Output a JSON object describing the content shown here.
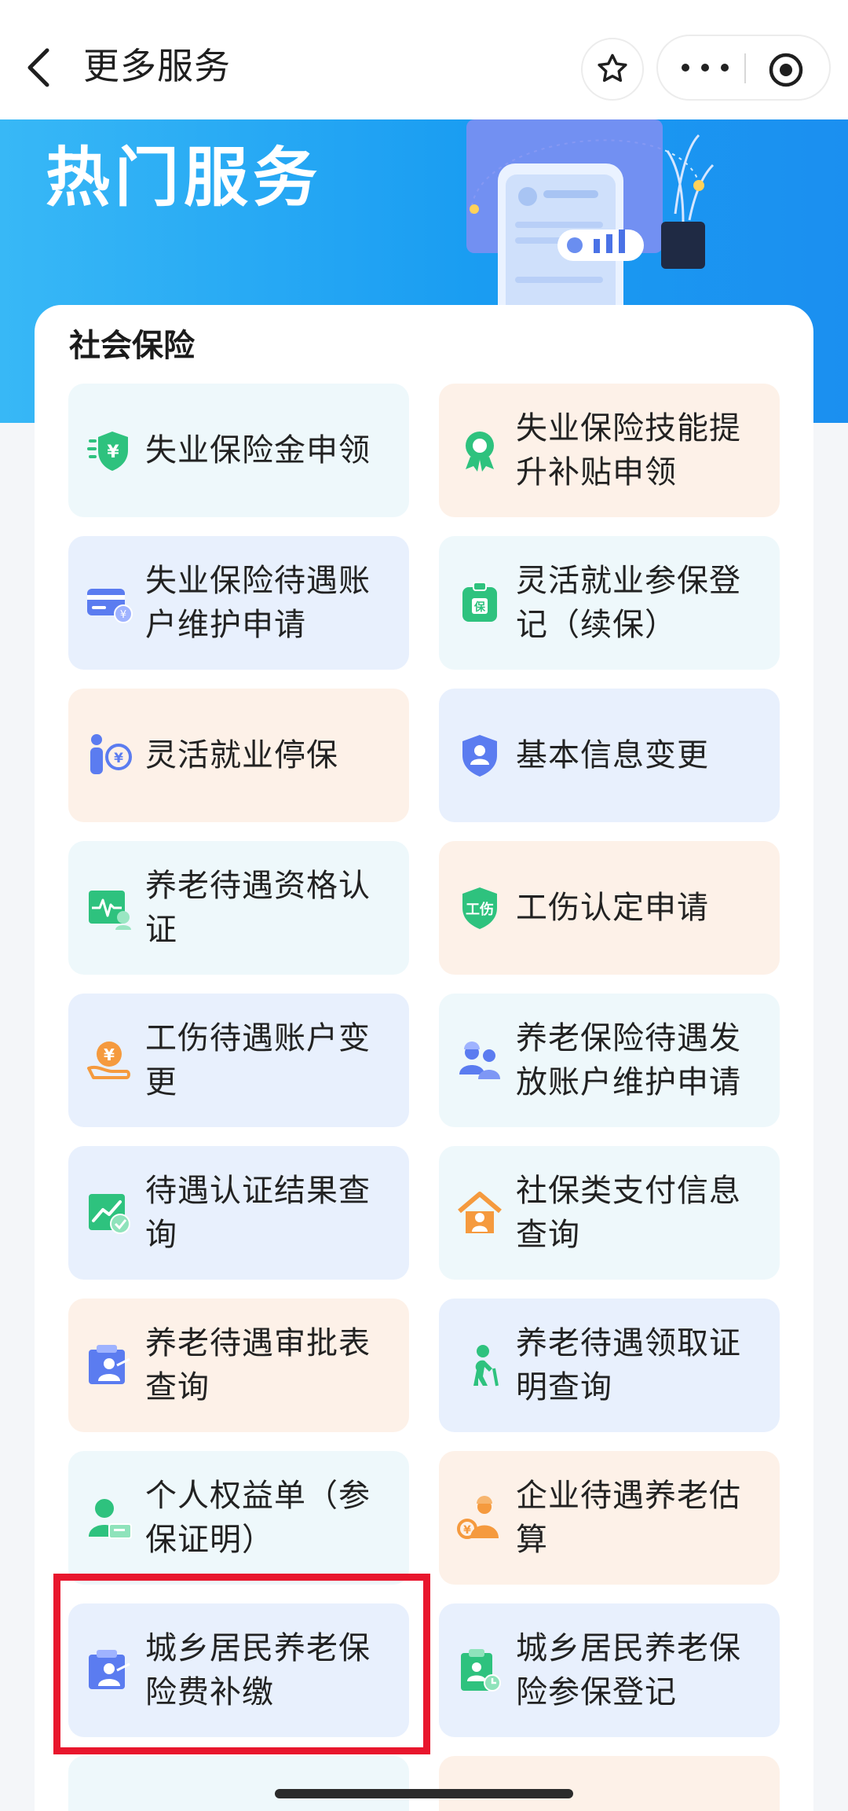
{
  "nav": {
    "title": "更多服务"
  },
  "banner": {
    "title": "热门服务"
  },
  "section": {
    "title": "社会保险"
  },
  "colors": {
    "primary": "#1a9df2",
    "icon_green": "#2ec27e",
    "icon_orange": "#f59a3e",
    "icon_blue": "#5b7cf0",
    "highlight": "#e8162d"
  },
  "services": [
    {
      "label": "失业保险金申领",
      "icon": "shield-yen-icon"
    },
    {
      "label": "失业保险技能提升补贴申领",
      "icon": "award-badge-icon"
    },
    {
      "label": "失业保险待遇账户维护申请",
      "icon": "card-edit-icon"
    },
    {
      "label": "灵活就业参保登记（续保）",
      "icon": "bag-document-icon"
    },
    {
      "label": "灵活就业停保",
      "icon": "person-coin-icon"
    },
    {
      "label": "基本信息变更",
      "icon": "person-shield-icon"
    },
    {
      "label": "养老待遇资格认证",
      "icon": "health-monitor-icon"
    },
    {
      "label": "工伤认定申请",
      "icon": "injury-shield-icon"
    },
    {
      "label": "工伤待遇账户变更",
      "icon": "hand-coin-icon"
    },
    {
      "label": "养老保险待遇发放账户维护申请",
      "icon": "workers-icon"
    },
    {
      "label": "待遇认证结果查询",
      "icon": "chart-check-icon"
    },
    {
      "label": "社保类支付信息查询",
      "icon": "house-person-icon"
    },
    {
      "label": "养老待遇审批表查询",
      "icon": "elder-document-icon"
    },
    {
      "label": "养老待遇领取证明查询",
      "icon": "elder-walking-icon"
    },
    {
      "label": "个人权益单（参保证明）",
      "icon": "person-card-icon"
    },
    {
      "label": "企业待遇养老估算",
      "icon": "worker-calc-icon"
    },
    {
      "label": "城乡居民养老保险费补缴",
      "icon": "elder-document-icon"
    },
    {
      "label": "城乡居民养老保险参保登记",
      "icon": "clipboard-person-icon"
    }
  ]
}
